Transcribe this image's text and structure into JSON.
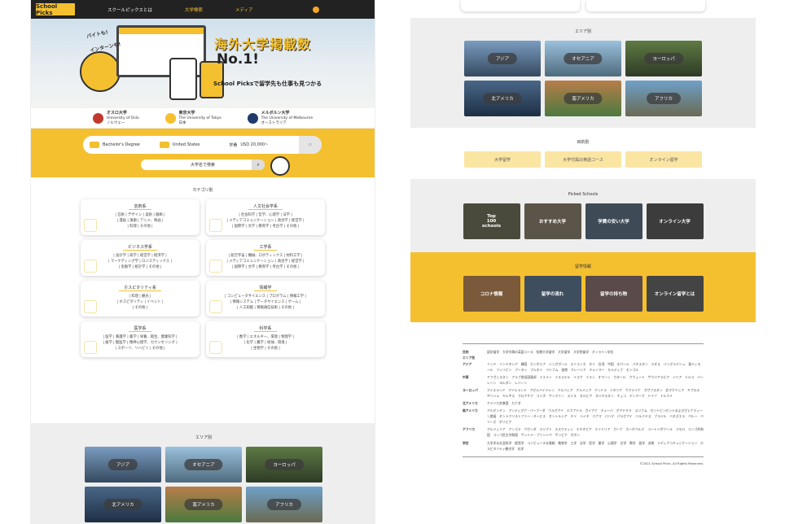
{
  "brand": {
    "logo": "School Picks",
    "accent": "#f5c030",
    "dark": "#222222"
  },
  "nav": {
    "items": [
      "スクールピックスとは",
      "大学検索",
      "メディア"
    ],
    "user_icon": "user-icon"
  },
  "hero": {
    "bubble1": "バイトも!",
    "bubble2": "インターンも!",
    "title": "海外大学掲載数",
    "no1": "No.1!",
    "subtitle": "School Picksで留学先も仕事も見つかる"
  },
  "unis": [
    {
      "name": "オスロ大学",
      "en": "University of Oslo",
      "country": "ノルウェー",
      "color": "#c0392b"
    },
    {
      "name": "東京大学",
      "en": "The University of Tokyo",
      "country": "日本",
      "color": "#f5c030"
    },
    {
      "name": "メルボルン大学",
      "en": "The University of Melbourne",
      "country": "オーストラリア",
      "color": "#1f3a6b"
    }
  ],
  "search": {
    "degree": "Bachelor's Degree",
    "country": "United States",
    "fee_label": "学費",
    "fee": "USD 20,000~",
    "field_placeholder": "大学名で検索"
  },
  "categories": {
    "title": "カテゴリ別",
    "items": [
      {
        "title": "芸術系",
        "body": "| 芸術 | デザイン | 美術 | 服飾 |\n| 漫画 | 演劇 | アニメ、映画 |\n| 料理 | その他 |"
      },
      {
        "title": "人文社会学系",
        "body": "| 社会科学 | 哲学、心理学 | 法学 |\n| メディアコミュニケーション | 政治学 | 経営学 |\n| 国際学 | 文学 | 教育学 | 考古学 | その他 |"
      },
      {
        "title": "ビジネス学系",
        "body": "| 会計学 | 商学 | 経営学 | 経済学 |\n| マーケティング学 | ロジスティックス |\n| 金融学 | 統計学 | その他 |"
      },
      {
        "title": "工学系",
        "body": "| 航空宇宙 | 機械、ロボティックス | 材料工学 |\n| メディアコミュニケーション | 政治学 | 経営学 |\n| 国際学 | 文学 | 教育学 | 考古学 | その他 |"
      },
      {
        "title": "ホスピタリティ系",
        "body": "| 料理 | 観光 |\n| ホスピタリティ | イベント |\n| その他 |"
      },
      {
        "title": "情報学",
        "body": "| コンピュータサイエンス | プログラム | 情報工学 |\n| 情報システム | データサイエンス | ゲーム |\n| 人工知能 | 情報通信技術 | その他 |"
      },
      {
        "title": "医学系",
        "body": "| 医学 | 看護学 | 薬学 | 栄養、衛生、健康科学 |\n| 歯学 | 獣医学 | 精神心理学、カウンセリング |\n| スポーツ、リハビリ | その他 |"
      },
      {
        "title": "科学系",
        "body": "| 数学 | エネルギー、環境 | 物理学 |\n| 化学 | 農学 | 地球、環境 |\n| 生物学 | その他 |"
      }
    ]
  },
  "areas": {
    "title": "エリア別",
    "items": [
      "アジア",
      "オセアニア",
      "ヨーロッパ",
      "北アメリカ",
      "南アメリカ",
      "アフリカ"
    ]
  },
  "purpose": {
    "title": "目的別",
    "items": [
      "大学留学",
      "大学付属の英語コース",
      "オンライン留学"
    ]
  },
  "picked": {
    "title": "Picked Schools",
    "items": [
      "Top\n100 schools",
      "おすすめ大学",
      "学費の安い大学",
      "オンライン大学"
    ]
  },
  "info": {
    "title": "留学情報",
    "items": [
      "コロナ情報",
      "留学の流れ",
      "留学の持ち物",
      "オンライン留学とは"
    ]
  },
  "footer": {
    "purpose": {
      "k": "目的",
      "v": "語学留学　大学付属の英語コース　短期大学留学　大学留学　大学院留学　オンライン学位"
    },
    "area_label": "エリア別",
    "regions": [
      {
        "k": "アジア",
        "v": "インド　インドネシア　韓国　カンボジア　シンガポール　スリランカ　タイ　台湾　中国　ネパール パキスタン　ラオス　バングラデシュ　東ティモール　フィリピン　ブータン　ブルネイ ベトナム　香港　マレーシア　ミャンマー　モルディブ　モンゴル"
      },
      {
        "k": "中東",
        "v": "アフガニスタン　アラブ首長国連邦　イエメン　イスラエル　イラク　イラン　オマーン　カタール クウェート　サウジアラビア　シリア　トルコ　バーレーン　ヨルダン　レバノン"
      },
      {
        "k": "ヨーロッパ",
        "v": "アイスランド　アイルランド　アゼルバイジャン　アルバニア　アルメニア　アンドラ　イタリア　ウクライナ カザフスタン　北マケドニア　キプロス　ギリシャ　キルギス　クロアチア　コソボ　サンマリノ　スイス セルビア　タジキスタン　チェコ　デンマーク　ドイツ　トルクメ"
      },
      {
        "k": "北アメリカ",
        "v": "アメリカ合衆国　カナダ"
      },
      {
        "k": "南アメリカ",
        "v": "アルゼンチン　アンティグア・バーブーダ　ウルグアイ　エクアドル　ガイアナ　キューバ　グアテマラ スリナム　セントビンセントおよびグレナディーン諸島　セントクリストファー・ネービス　セントルシア　チリ ハイチ　パナマ　バハマ　パラグアイ　バルバドス　ブラジル　ベネズエラ　ペルー　ベリーズ　ボリビア"
      },
      {
        "k": "アフリカ",
        "v": "アルジェリア　アンゴラ　ウガンダ　エジプト　エスワティニ　エチオピア　エリトリア　ガーナ　カーボベルデ コートジボワール　コモロ　コンゴ共和国　コンゴ民主共和国　サントメ・プリンシペ　ザンビア　ガボン"
      }
    ],
    "study": {
      "k": "学位",
      "v": "大学学＆社会科学　経営学　コンピュータ＆情報　教育学　工学　法学　医学　薬学　心理学 文学　数学　語学　芸術　メディアコミュニケーション　ホスピタリティ観光学　化学"
    },
    "copyright": "©2021 School Picks. All Rights Reserved."
  }
}
